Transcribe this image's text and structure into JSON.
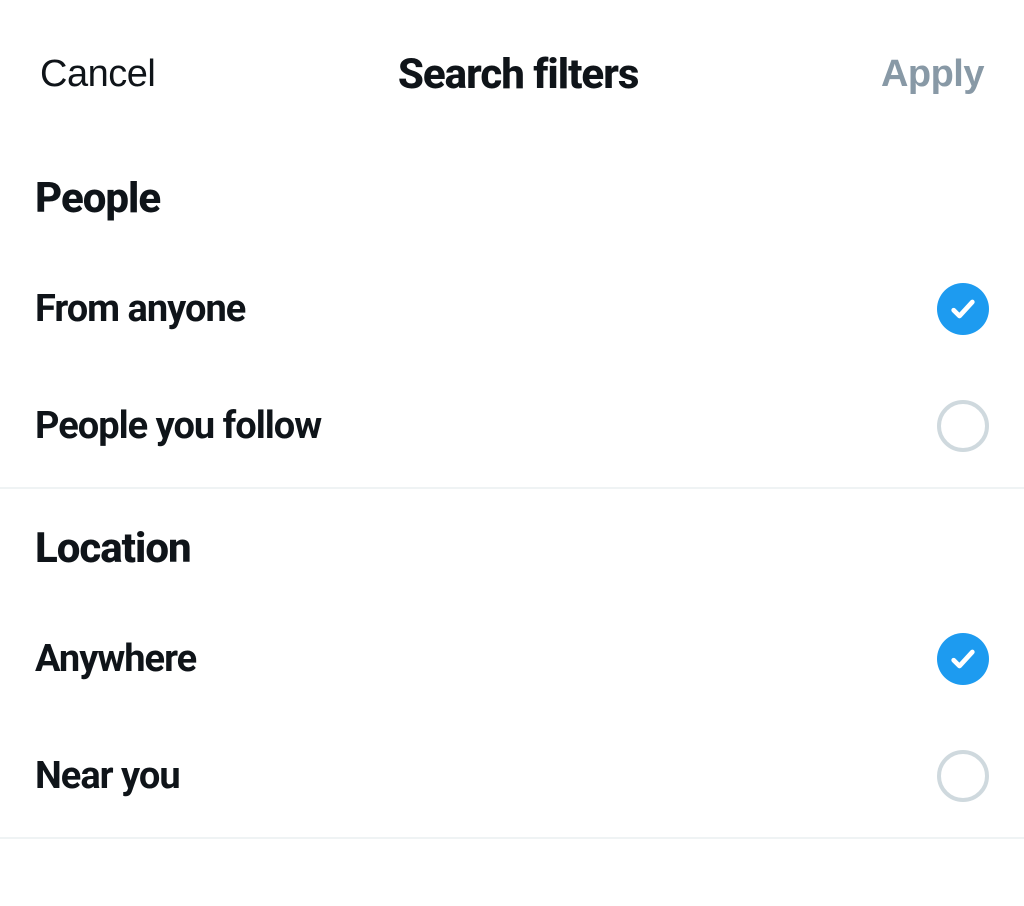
{
  "header": {
    "cancel": "Cancel",
    "title": "Search filters",
    "apply": "Apply"
  },
  "sections": {
    "people": {
      "title": "People",
      "options": {
        "anyone": {
          "label": "From anyone",
          "selected": true
        },
        "following": {
          "label": "People you follow",
          "selected": false
        }
      }
    },
    "location": {
      "title": "Location",
      "options": {
        "anywhere": {
          "label": "Anywhere",
          "selected": true
        },
        "near": {
          "label": "Near you",
          "selected": false
        }
      }
    }
  }
}
